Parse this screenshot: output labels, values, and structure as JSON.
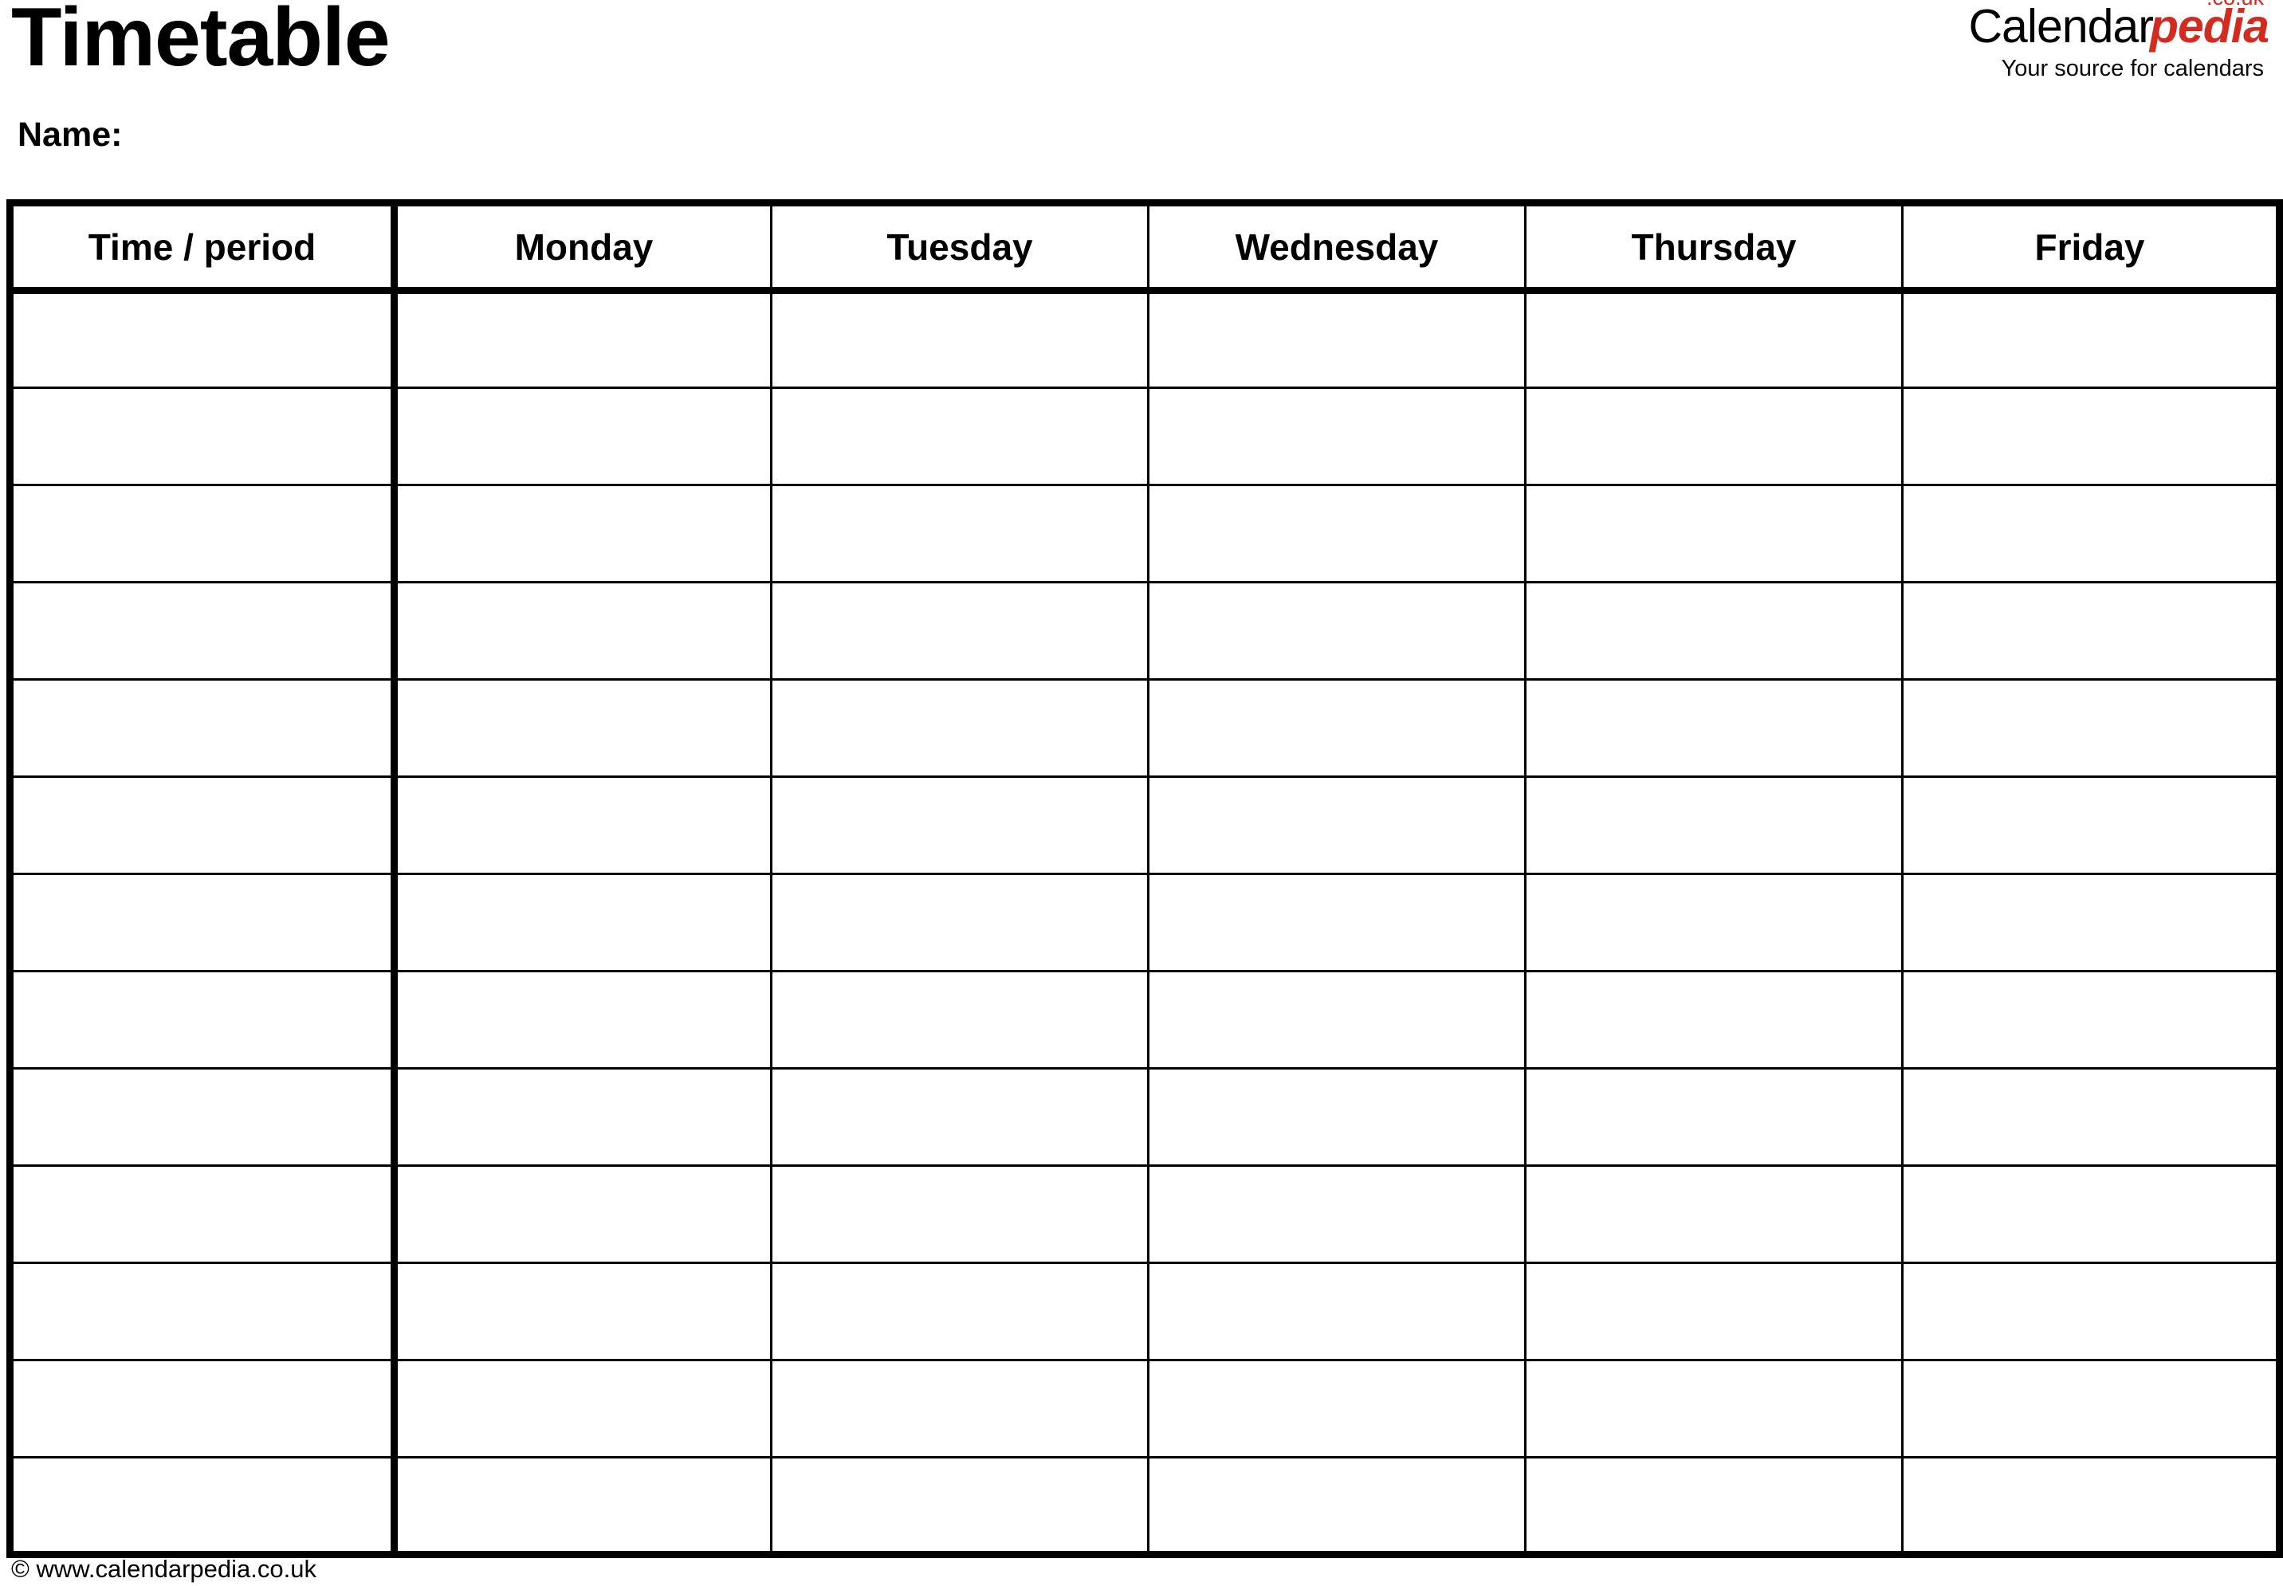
{
  "document": {
    "title": "Timetable",
    "name_label": "Name:"
  },
  "brand": {
    "name_primary": "Calendar",
    "name_secondary": "pedia",
    "tld": ".co.uk",
    "tagline": "Your source for calendars",
    "accent_color": "#d22b20",
    "primary_color": "#000000"
  },
  "table": {
    "columns": [
      {
        "key": "time",
        "label": "Time / period"
      },
      {
        "key": "monday",
        "label": "Monday"
      },
      {
        "key": "tuesday",
        "label": "Tuesday"
      },
      {
        "key": "wednesday",
        "label": "Wednesday"
      },
      {
        "key": "thursday",
        "label": "Thursday"
      },
      {
        "key": "friday",
        "label": "Friday"
      }
    ],
    "row_count": 13,
    "rows": [
      {
        "time": "",
        "monday": "",
        "tuesday": "",
        "wednesday": "",
        "thursday": "",
        "friday": ""
      },
      {
        "time": "",
        "monday": "",
        "tuesday": "",
        "wednesday": "",
        "thursday": "",
        "friday": ""
      },
      {
        "time": "",
        "monday": "",
        "tuesday": "",
        "wednesday": "",
        "thursday": "",
        "friday": ""
      },
      {
        "time": "",
        "monday": "",
        "tuesday": "",
        "wednesday": "",
        "thursday": "",
        "friday": ""
      },
      {
        "time": "",
        "monday": "",
        "tuesday": "",
        "wednesday": "",
        "thursday": "",
        "friday": ""
      },
      {
        "time": "",
        "monday": "",
        "tuesday": "",
        "wednesday": "",
        "thursday": "",
        "friday": ""
      },
      {
        "time": "",
        "monday": "",
        "tuesday": "",
        "wednesday": "",
        "thursday": "",
        "friday": ""
      },
      {
        "time": "",
        "monday": "",
        "tuesday": "",
        "wednesday": "",
        "thursday": "",
        "friday": ""
      },
      {
        "time": "",
        "monday": "",
        "tuesday": "",
        "wednesday": "",
        "thursday": "",
        "friday": ""
      },
      {
        "time": "",
        "monday": "",
        "tuesday": "",
        "wednesday": "",
        "thursday": "",
        "friday": ""
      },
      {
        "time": "",
        "monday": "",
        "tuesday": "",
        "wednesday": "",
        "thursday": "",
        "friday": ""
      },
      {
        "time": "",
        "monday": "",
        "tuesday": "",
        "wednesday": "",
        "thursday": "",
        "friday": ""
      },
      {
        "time": "",
        "monday": "",
        "tuesday": "",
        "wednesday": "",
        "thursday": "",
        "friday": ""
      }
    ]
  },
  "footer": {
    "copyright": "© www.calendarpedia.co.uk"
  }
}
